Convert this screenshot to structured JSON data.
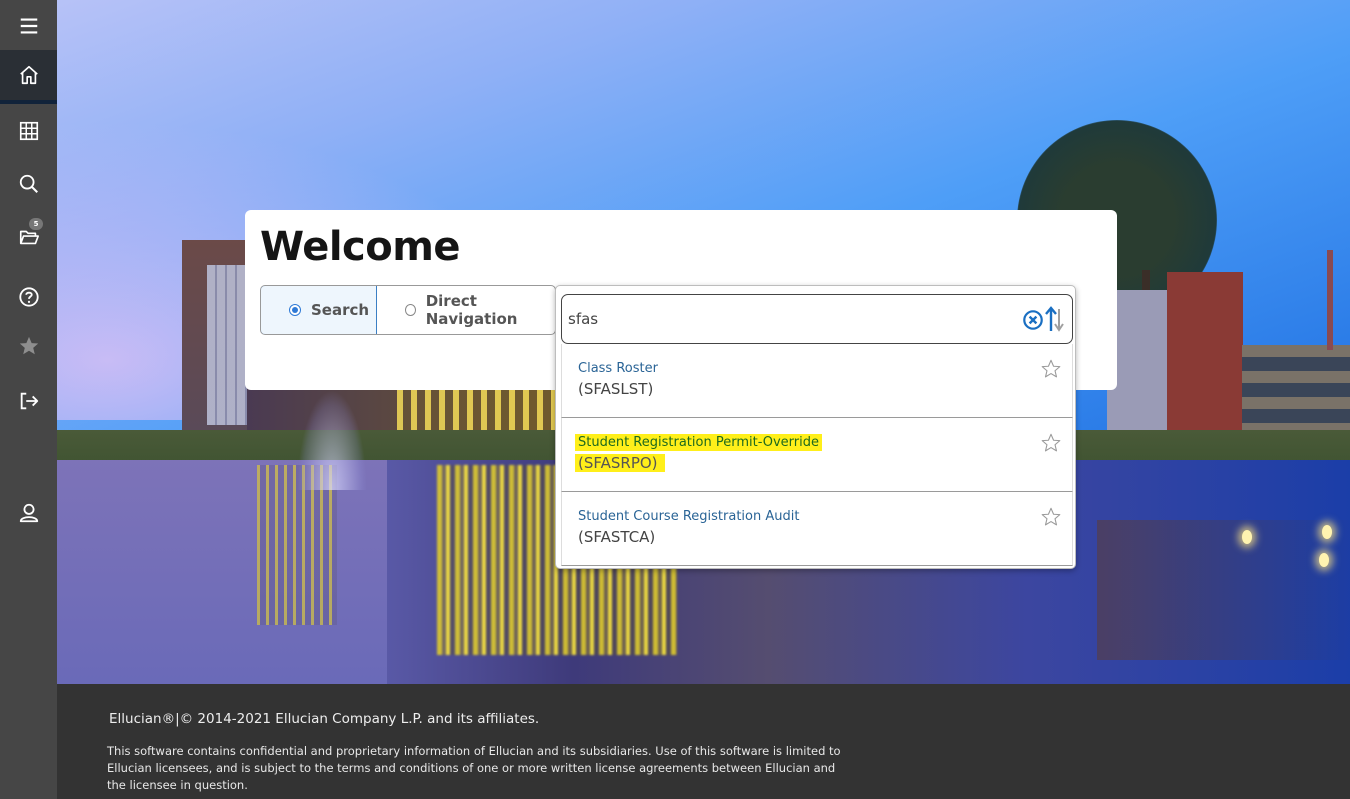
{
  "sidebar": {
    "items": [
      {
        "name": "menu",
        "icon": "hamburger-menu-icon"
      },
      {
        "name": "home",
        "icon": "home-icon",
        "active": true
      },
      {
        "name": "applications",
        "icon": "grid-icon"
      },
      {
        "name": "search",
        "icon": "search-icon"
      },
      {
        "name": "recent",
        "icon": "folder-open-icon",
        "badge": "5"
      },
      {
        "name": "help",
        "icon": "help-circle-icon"
      },
      {
        "name": "favorites",
        "icon": "star-icon"
      },
      {
        "name": "sign-out",
        "icon": "sign-out-icon"
      },
      {
        "name": "user-profile",
        "icon": "user-icon"
      }
    ]
  },
  "welcome": {
    "title": "Welcome",
    "modes": [
      {
        "label": "Search",
        "selected": true
      },
      {
        "label": "Direct Navigation",
        "selected": false
      }
    ]
  },
  "search": {
    "value": "sfas",
    "placeholder": "",
    "clear_icon": "clear-circle-icon",
    "sort_icon": "sort-arrows-icon",
    "results": [
      {
        "name": "Class Roster",
        "code": "(SFASLST)",
        "highlighted": false,
        "favorite": false
      },
      {
        "name": "Student Registration Permit-Override",
        "code": "(SFASRPO)",
        "highlighted": true,
        "favorite": false
      },
      {
        "name": "Student Course Registration Audit",
        "code": "(SFASTCA)",
        "highlighted": false,
        "favorite": false
      }
    ]
  },
  "footer": {
    "copyright": "Ellucian®|© 2014-2021 Ellucian Company L.P. and its affiliates.",
    "legal": "This software contains confidential and proprietary information of Ellucian and its subsidiaries. Use of this software is limited to Ellucian licensees, and is subject to the terms and conditions of one or more written license agreements between Ellucian and the licensee in question."
  },
  "colors": {
    "sidebar_bg": "#464646",
    "sidebar_active": "#2a2f35",
    "accent_blue": "#2f7ad6",
    "link_blue": "#2a6496",
    "highlight_yellow": "#ffef1a",
    "footer_bg": "#333333"
  }
}
